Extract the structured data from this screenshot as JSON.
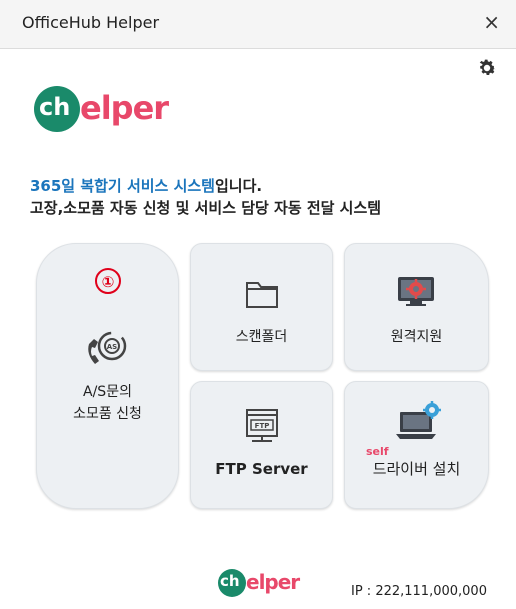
{
  "window": {
    "title": "OfficeHub Helper",
    "close_glyph": "×"
  },
  "logo": {
    "circle_text": "ch",
    "rest_text": "elper"
  },
  "tagline": {
    "highlight": "365일 복합기 서비스 시스템",
    "suffix": "입니다.",
    "line2": "고장,소모품 자동 신청 및 서비스 담당 자동 전달 시스템"
  },
  "tiles": {
    "as": {
      "badge": "①",
      "label_line1": "A/S문의",
      "label_line2": "소모품 신청",
      "icon": "phone-support-icon"
    },
    "scan": {
      "label": "스캔폴더",
      "icon": "folder-icon"
    },
    "remote": {
      "label": "원격지원",
      "icon": "remote-gear-monitor-icon"
    },
    "ftp": {
      "label": "FTP Server",
      "icon": "ftp-server-icon",
      "icon_text": "FTP"
    },
    "driver": {
      "self": "self",
      "label": "드라이버 설치",
      "icon": "laptop-gear-icon"
    }
  },
  "footer": {
    "logo": {
      "circle_text": "ch",
      "rest_text": "elper"
    },
    "ip": "IP : 222,111,000,000"
  },
  "colors": {
    "brand_green": "#1a8a6a",
    "brand_pink": "#e8486a",
    "highlight_blue": "#1b75bc",
    "badge_red": "#e0001a"
  }
}
